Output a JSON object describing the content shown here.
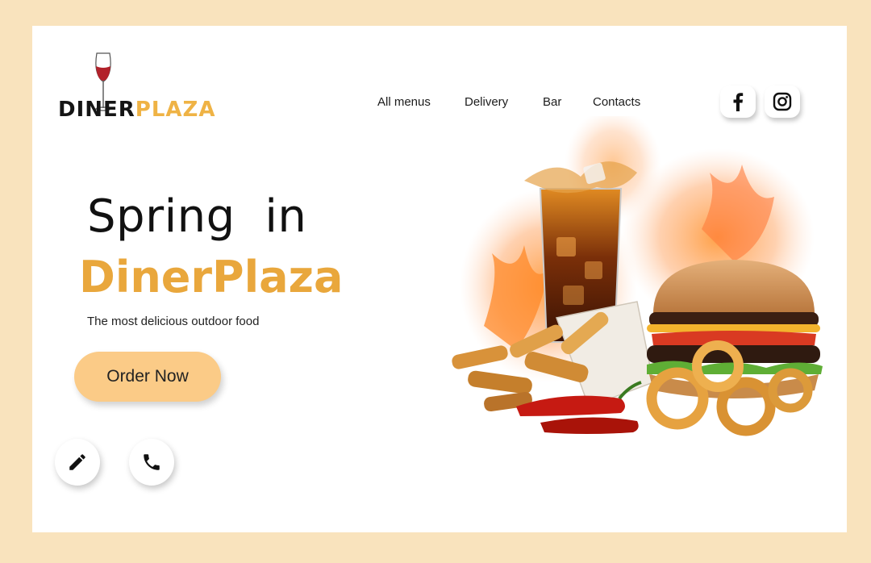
{
  "brand": {
    "part1": "DINER",
    "part2": "PLAZA"
  },
  "nav": {
    "items": [
      "All menus",
      "Delivery",
      "Bar",
      "Contacts"
    ]
  },
  "social": {
    "facebook": "facebook-icon",
    "instagram": "instagram-icon"
  },
  "hero": {
    "title_line1": "Spring  in",
    "title_line2": "DinerPlaza",
    "subtitle": "The most delicious outdoor food",
    "cta_label": "Order Now"
  },
  "actions": {
    "edit_icon": "pencil-icon",
    "call_icon": "phone-icon"
  },
  "colors": {
    "page_background": "#f9e3bd",
    "accent": "#e9a73c",
    "cta_background": "#fbcb87",
    "text": "#111111"
  }
}
